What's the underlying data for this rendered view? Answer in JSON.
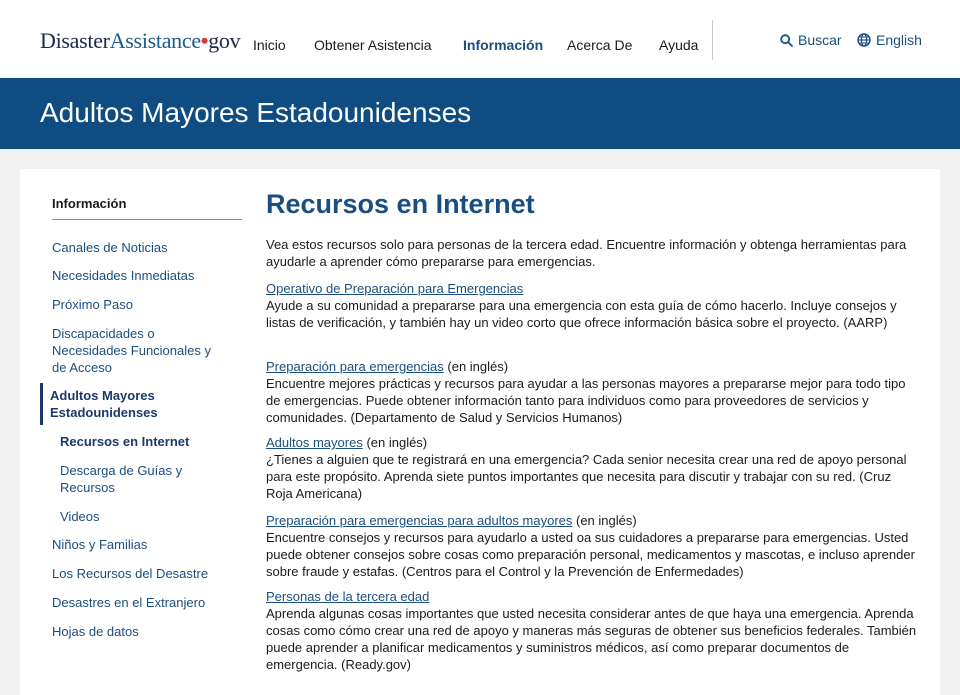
{
  "logo": {
    "part1": "Disaster",
    "part2": "Assistance",
    "dot": "•",
    "part3": "gov"
  },
  "nav": {
    "items": [
      {
        "label": "Inicio"
      },
      {
        "label": "Obtener Asistencia"
      },
      {
        "label": "Información"
      },
      {
        "label": "Acerca De"
      },
      {
        "label": "Ayuda"
      }
    ],
    "active": "Información"
  },
  "utility": {
    "search_label": "Buscar",
    "language_label": "English"
  },
  "banner": {
    "title": "Adultos Mayores Estadounidenses"
  },
  "sidebar": {
    "heading": "Información",
    "items": [
      {
        "label": "Canales de Noticias"
      },
      {
        "label": "Necesidades Inmediatas"
      },
      {
        "label": "Próximo Paso"
      },
      {
        "label": "Discapacidades o Necesidades Funcionales y de Acceso"
      },
      {
        "label": "Adultos Mayores Estadounidenses"
      },
      {
        "label": "Recursos en Internet"
      },
      {
        "label": "Descarga de Guías y Recursos"
      },
      {
        "label": "Videos"
      },
      {
        "label": "Niños y Familias"
      },
      {
        "label": "Los Recursos del Desastre"
      },
      {
        "label": "Desastres en el Extranjero"
      },
      {
        "label": "Hojas de datos"
      }
    ]
  },
  "main": {
    "title": "Recursos en Internet",
    "intro": "Vea estos recursos solo para personas de la tercera edad. Encuentre información y obtenga herramientas para ayudarle a aprender cómo prepararse para emergencias.",
    "resources": [
      {
        "link": "Operativo de Preparación para Emergencias",
        "note": "",
        "desc": "Ayude a su comunidad a prepararse para una emergencia con esta guía de cómo hacerlo. Incluye consejos y listas de verificación, y también hay un video corto que ofrece información básica sobre el proyecto. (AARP)"
      },
      {
        "link": "Preparación para emergencias",
        "note": " (en inglés)",
        "desc": "Encuentre mejores prácticas y recursos para ayudar a las personas mayores a prepararse mejor para todo tipo de emergencias. Puede obtener información tanto para individuos como para proveedores de servicios y comunidades. (Departamento de Salud y Servicios Humanos)"
      },
      {
        "link": "Adultos mayores",
        "note": " (en inglés)",
        "desc": "¿Tienes a alguien que te registrará en una emergencia? Cada senior necesita crear una red de apoyo personal para este propósito. Aprenda siete puntos importantes que necesita para discutir y trabajar con su red. (Cruz Roja Americana)"
      },
      {
        "link": "Preparación para emergencias para adultos mayores",
        "note": " (en inglés)",
        "desc": "Encuentre consejos y recursos para ayudarlo a usted oa sus cuidadores a prepararse para emergencias. Usted puede obtener consejos sobre cosas como preparación personal, medicamentos y mascotas, e incluso aprender sobre fraude y estafas. (Centros para el Control y la Prevención de Enfermedades)"
      },
      {
        "link": "Personas de la tercera edad",
        "note": "",
        "desc": "Aprenda algunas cosas importantes que usted necesita considerar antes de que haya una emergencia. Aprenda cosas como cómo crear una red de apoyo y maneras más seguras de obtener sus beneficios federales. También puede aprender a planificar medicamentos y suministros médicos, así como preparar documentos de emergencia. (Ready.gov)"
      }
    ]
  },
  "colors": {
    "brand": "#0f4c81",
    "link": "#1b4e80",
    "logo_dot": "#d83933"
  }
}
